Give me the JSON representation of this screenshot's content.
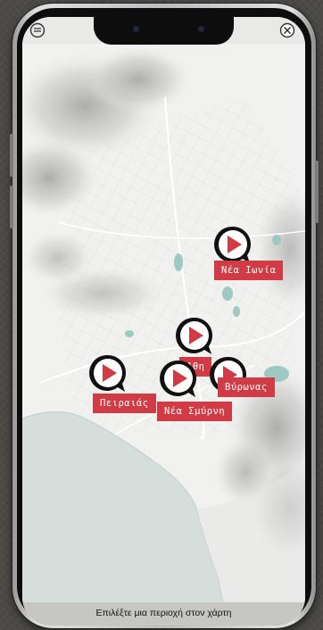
{
  "footer": {
    "instruction": "Επιλέξτε μια περιοχή στον χάρτη"
  },
  "places": [
    {
      "label": "Νέα Ιωνία"
    },
    {
      "label": "Αθη"
    },
    {
      "label": "Βύρωνας"
    },
    {
      "label": "Πειραιάς"
    },
    {
      "label": "Νέα Σμύρνη"
    }
  ],
  "colors": {
    "marker_red": "#d13b45",
    "map_land": "#f1f1ef",
    "map_sea": "#d5dedb"
  },
  "icons": {
    "top_left": "menu-circle-icon",
    "top_right": "close-icon",
    "marker": "play-speech-bubble-icon"
  }
}
